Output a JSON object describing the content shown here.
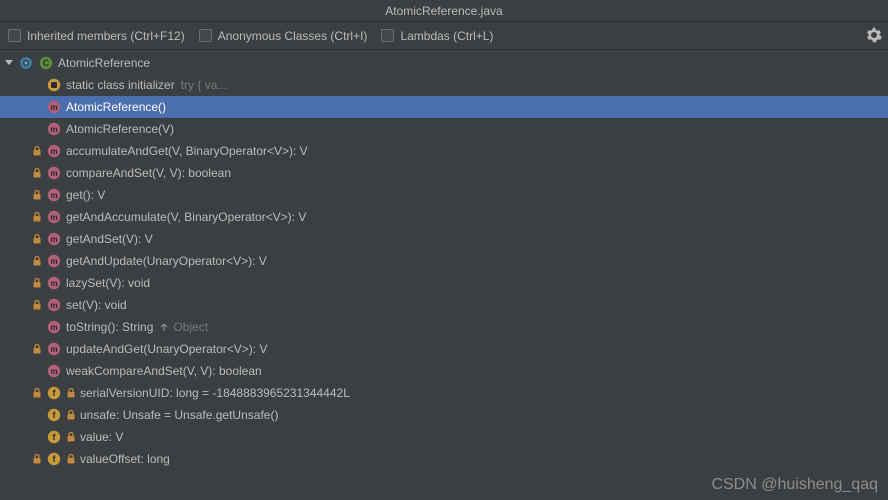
{
  "title": "AtomicReference.java",
  "toolbar": {
    "inherited": "Inherited members (Ctrl+F12)",
    "anonymous": "Anonymous Classes (Ctrl+I)",
    "lambdas": "Lambdas (Ctrl+L)"
  },
  "tree": {
    "root": {
      "name": "AtomicReference"
    },
    "items": [
      {
        "kind": "initializer",
        "label": "static class initializer",
        "extra_faded": "try {          va..."
      },
      {
        "kind": "method",
        "label": "AtomicReference()",
        "selected": true
      },
      {
        "kind": "method",
        "label": "AtomicReference(V)"
      },
      {
        "kind": "method",
        "label": "accumulateAndGet(V, BinaryOperator<V>): V",
        "locked": true
      },
      {
        "kind": "method",
        "label": "compareAndSet(V, V): boolean",
        "locked": true
      },
      {
        "kind": "method",
        "label": "get(): V",
        "locked": true
      },
      {
        "kind": "method",
        "label": "getAndAccumulate(V, BinaryOperator<V>): V",
        "locked": true
      },
      {
        "kind": "method",
        "label": "getAndSet(V): V",
        "locked": true
      },
      {
        "kind": "method",
        "label": "getAndUpdate(UnaryOperator<V>): V",
        "locked": true
      },
      {
        "kind": "method",
        "label": "lazySet(V): void",
        "locked": true
      },
      {
        "kind": "method",
        "label": "set(V): void",
        "locked": true
      },
      {
        "kind": "method",
        "label": "toString(): String",
        "override": "Object"
      },
      {
        "kind": "method",
        "label": "updateAndGet(UnaryOperator<V>): V",
        "locked": true
      },
      {
        "kind": "method",
        "label": "weakCompareAndSet(V, V): boolean"
      },
      {
        "kind": "field",
        "label": "serialVersionUID: long = -1848883965231344442L",
        "locked": true,
        "fieldLock": true
      },
      {
        "kind": "field",
        "label": "unsafe: Unsafe = Unsafe.getUnsafe()",
        "fieldLock": true
      },
      {
        "kind": "field",
        "label": "value: V",
        "fieldLock": true
      },
      {
        "kind": "field",
        "label": "valueOffset: long",
        "locked": true,
        "fieldLock": true
      }
    ]
  },
  "watermark": "CSDN @huisheng_qaq"
}
